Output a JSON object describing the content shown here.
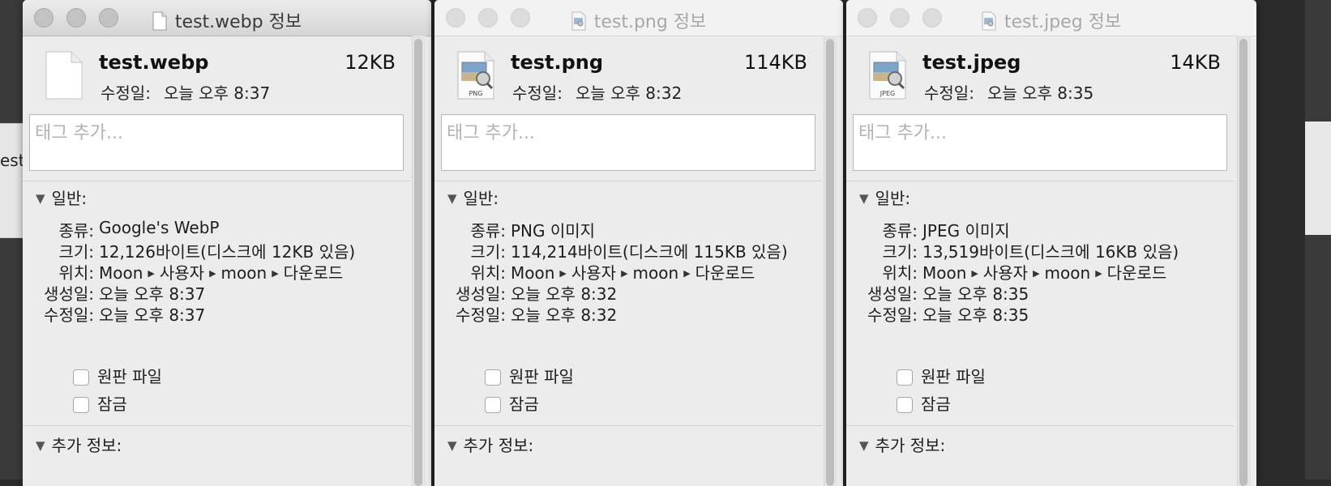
{
  "windows": [
    {
      "title": "test.webp 정보",
      "file_name": "test.webp",
      "file_size": "12KB",
      "modified_label": "수정일:",
      "modified_value": "오늘 오후 8:37",
      "tags_placeholder": "태그 추가...",
      "general_label": "일반:",
      "kind_label": "종류:",
      "kind_value": "Google's WebP",
      "size_label": "크기:",
      "size_value": "12,126바이트(디스크에 12KB 있음)",
      "where_label": "위치:",
      "where_parts": [
        "Moon",
        "사용자",
        "moon",
        "다운로드"
      ],
      "created_label": "생성일:",
      "created_value": "오늘 오후 8:37",
      "modified2_label": "수정일:",
      "modified2_value": "오늘 오후 8:37",
      "stationery_label": "원판 파일",
      "locked_label": "잠금",
      "more_info_label": "추가 정보:",
      "icon": "blank-document-icon"
    },
    {
      "title": "test.png 정보",
      "file_name": "test.png",
      "file_size": "114KB",
      "modified_label": "수정일:",
      "modified_value": "오늘 오후 8:32",
      "tags_placeholder": "태그 추가...",
      "general_label": "일반:",
      "kind_label": "종류:",
      "kind_value": "PNG 이미지",
      "size_label": "크기:",
      "size_value": "114,214바이트(디스크에 115KB 있음)",
      "where_label": "위치:",
      "where_parts": [
        "Moon",
        "사용자",
        "moon",
        "다운로드"
      ],
      "created_label": "생성일:",
      "created_value": "오늘 오후 8:32",
      "modified2_label": "수정일:",
      "modified2_value": "오늘 오후 8:32",
      "stationery_label": "원판 파일",
      "locked_label": "잠금",
      "more_info_label": "추가 정보:",
      "icon": "png-image-icon",
      "icon_badge": "PNG"
    },
    {
      "title": "test.jpeg 정보",
      "file_name": "test.jpeg",
      "file_size": "14KB",
      "modified_label": "수정일:",
      "modified_value": "오늘 오후 8:35",
      "tags_placeholder": "태그 추가...",
      "general_label": "일반:",
      "kind_label": "종류:",
      "kind_value": "JPEG 이미지",
      "size_label": "크기:",
      "size_value": "13,519바이트(디스크에 16KB 있음)",
      "where_label": "위치:",
      "where_parts": [
        "Moon",
        "사용자",
        "moon",
        "다운로드"
      ],
      "created_label": "생성일:",
      "created_value": "오늘 오후 8:35",
      "modified2_label": "수정일:",
      "modified2_value": "오늘 오후 8:35",
      "stationery_label": "원판 파일",
      "locked_label": "잠금",
      "more_info_label": "추가 정보:",
      "icon": "jpeg-image-icon",
      "icon_badge": "JPEG"
    }
  ],
  "background": {
    "left_text": "est."
  },
  "colors": {
    "window_bg": "#ececec",
    "titlebar_active": "#d5d5d5",
    "title_inactive": "#a8a8a8"
  }
}
